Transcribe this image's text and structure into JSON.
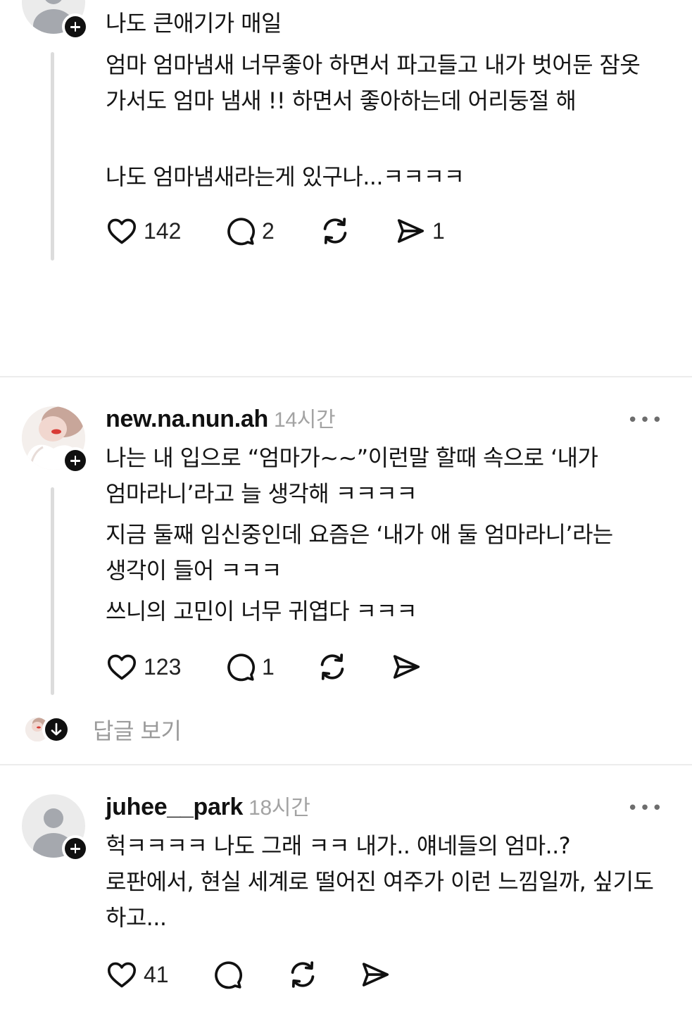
{
  "posts": [
    {
      "username": "",
      "time": "",
      "paragraphs": [
        "나도 큰애기가 매일",
        "엄마 엄마냄새 너무좋아 하면서 파고들고 내가 벗어둔 잠옷 가서도 엄마 냄새 !! 하면서 좋아하는데 어리둥절 해",
        "나도 엄마냄새라는게 있구나...ㅋㅋㅋㅋ"
      ],
      "likes": "142",
      "comments": "2",
      "shares": "1"
    },
    {
      "username": "new.na.nun.ah",
      "time": "14시간",
      "paragraphs": [
        "나는 내 입으로 “엄마가~~”이런말 할때 속으로 ‘내가 엄마라니’라고 늘 생각해 ㅋㅋㅋㅋ",
        "지금 둘째 임신중인데 요즘은 ‘내가 애 둘 엄마라니’라는 생각이 들어 ㅋㅋㅋ",
        "쓰니의 고민이 너무 귀엽다 ㅋㅋㅋ"
      ],
      "likes": "123",
      "comments": "1",
      "shares": "",
      "view_replies": "답글 보기"
    },
    {
      "username": "juhee__park",
      "time": "18시간",
      "paragraphs": [
        "헉ㅋㅋㅋㅋ 나도 그래 ㅋㅋ 내가.. 얘네들의 엄마..? 로판에서, 현실 세계로 떨어진 여주가 이런 느낌일까, 싶기도 하고..."
      ],
      "likes": "41",
      "comments": "",
      "shares": ""
    }
  ],
  "more_icon": "•••",
  "colors": {
    "text": "#111111",
    "muted": "#a3a3a3",
    "divider": "#ececec",
    "thread_line": "#dcdcdc"
  }
}
